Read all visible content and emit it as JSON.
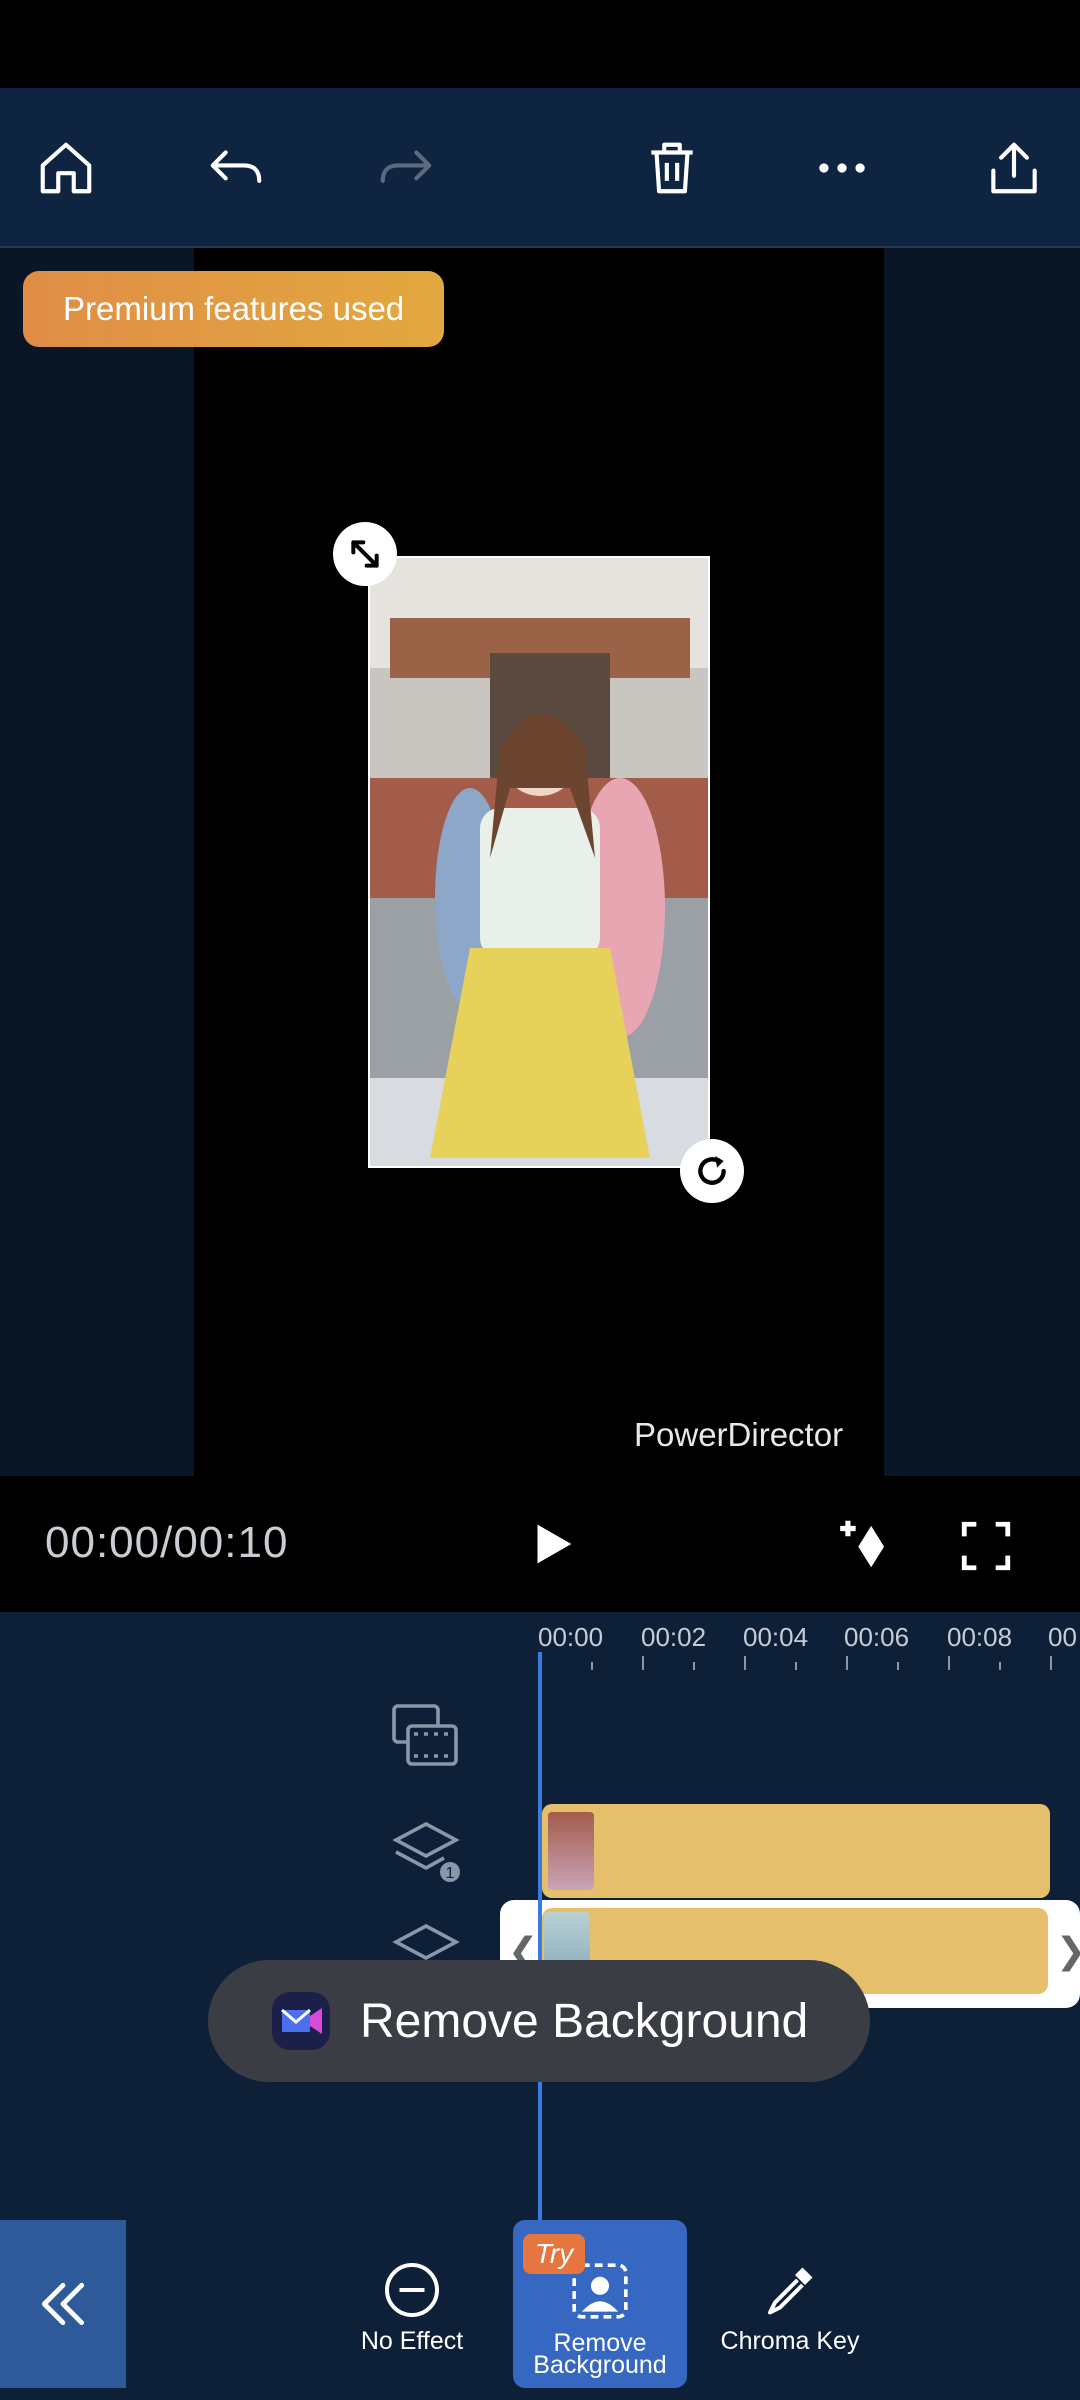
{
  "toolbar": {
    "home_icon": "home-icon",
    "undo_icon": "undo-icon",
    "redo_icon": "redo-icon",
    "delete_icon": "trash-icon",
    "more_icon": "more-horizontal-icon",
    "export_icon": "share-upload-icon"
  },
  "preview": {
    "premium_badge": "Premium features used",
    "watermark": "PowerDirector"
  },
  "playback": {
    "timecode": "00:00/00:10"
  },
  "timeline": {
    "ruler": [
      "00:00",
      "00:02",
      "00:04",
      "00:06",
      "00:08",
      "00"
    ],
    "toast": "Remove Background"
  },
  "effects": {
    "items": [
      {
        "label": "No Effect"
      },
      {
        "label_line1": "Remove",
        "label_line2": "Background",
        "badge": "Try"
      },
      {
        "label": "Chroma Key"
      }
    ]
  },
  "colors": {
    "accent": "#3668c2",
    "track": "#e6bf6c",
    "premium": "#e2a93f"
  }
}
